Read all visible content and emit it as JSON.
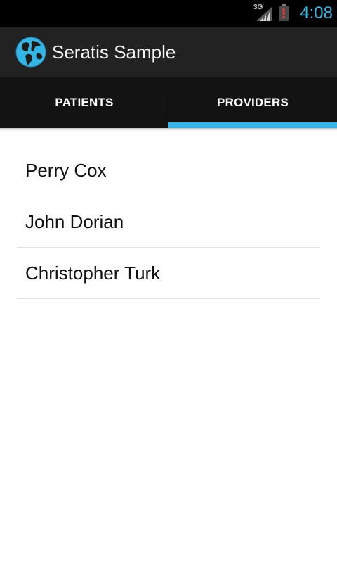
{
  "status_bar": {
    "network_type": "3G",
    "time": "4:08",
    "accent_color": "#33b5e5",
    "battery_alert_color": "#e53935"
  },
  "action_bar": {
    "app_icon": "globe-icon",
    "title": "Seratis Sample"
  },
  "tabs": [
    {
      "label": "PATIENTS",
      "selected": false
    },
    {
      "label": "PROVIDERS",
      "selected": true
    }
  ],
  "providers": [
    {
      "name": "Perry Cox"
    },
    {
      "name": "John Dorian"
    },
    {
      "name": "Christopher Turk"
    }
  ]
}
